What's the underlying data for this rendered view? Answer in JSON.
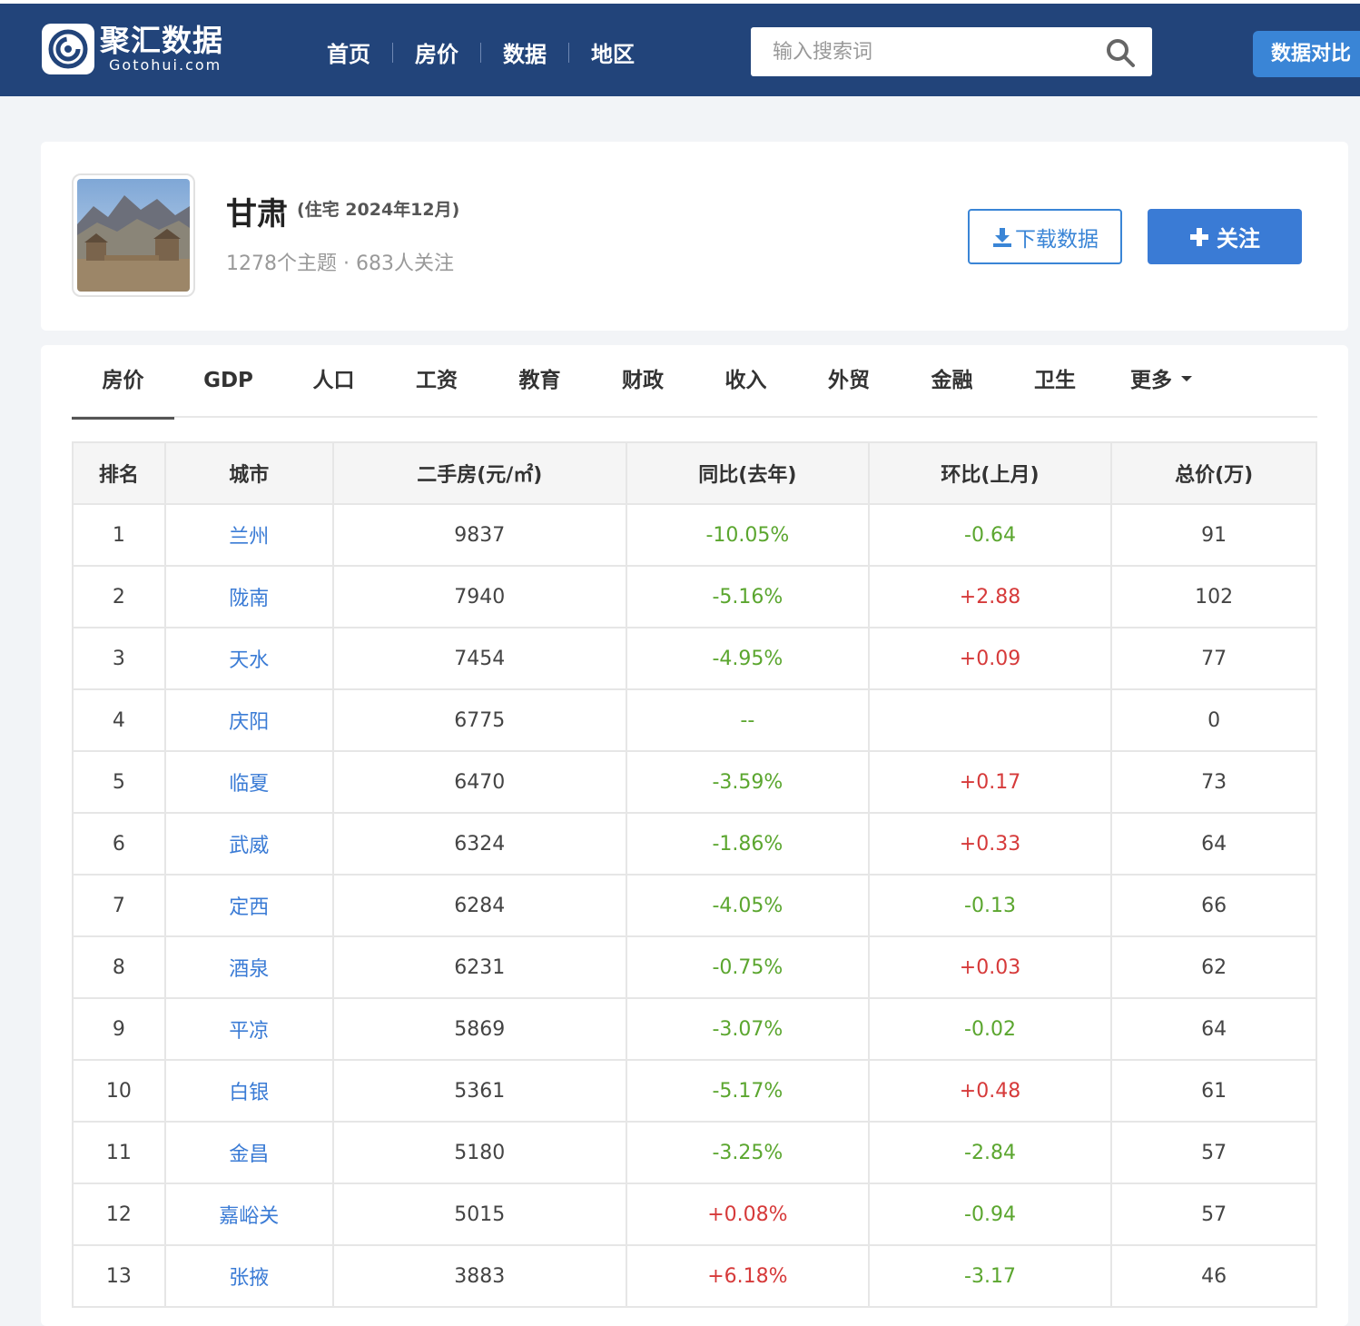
{
  "header": {
    "logo_name": "聚汇数据",
    "logo_domain": "Gotohui.com",
    "nav": [
      "首页",
      "房价",
      "数据",
      "地区"
    ],
    "search_placeholder": "输入搜索词",
    "compare_label": "数据对比"
  },
  "profile": {
    "title": "甘肃",
    "subtitle": "(住宅 2024年12月)",
    "meta": "1278个主题 · 683人关注",
    "download_label": "下载数据",
    "follow_label": "关注"
  },
  "tabs": [
    "房价",
    "GDP",
    "人口",
    "工资",
    "教育",
    "财政",
    "收入",
    "外贸",
    "金融",
    "卫生",
    "更多"
  ],
  "table": {
    "headers": [
      "排名",
      "城市",
      "二手房(元/㎡)",
      "同比(去年)",
      "环比(上月)",
      "总价(万)"
    ],
    "rows": [
      {
        "rank": "1",
        "city": "兰州",
        "price": "9837",
        "yoy": "-10.05%",
        "mom": "-0.64",
        "total": "91"
      },
      {
        "rank": "2",
        "city": "陇南",
        "price": "7940",
        "yoy": "-5.16%",
        "mom": "+2.88",
        "total": "102"
      },
      {
        "rank": "3",
        "city": "天水",
        "price": "7454",
        "yoy": "-4.95%",
        "mom": "+0.09",
        "total": "77"
      },
      {
        "rank": "4",
        "city": "庆阳",
        "price": "6775",
        "yoy": "--",
        "mom": "",
        "total": "0"
      },
      {
        "rank": "5",
        "city": "临夏",
        "price": "6470",
        "yoy": "-3.59%",
        "mom": "+0.17",
        "total": "73"
      },
      {
        "rank": "6",
        "city": "武威",
        "price": "6324",
        "yoy": "-1.86%",
        "mom": "+0.33",
        "total": "64"
      },
      {
        "rank": "7",
        "city": "定西",
        "price": "6284",
        "yoy": "-4.05%",
        "mom": "-0.13",
        "total": "66"
      },
      {
        "rank": "8",
        "city": "酒泉",
        "price": "6231",
        "yoy": "-0.75%",
        "mom": "+0.03",
        "total": "62"
      },
      {
        "rank": "9",
        "city": "平凉",
        "price": "5869",
        "yoy": "-3.07%",
        "mom": "-0.02",
        "total": "64"
      },
      {
        "rank": "10",
        "city": "白银",
        "price": "5361",
        "yoy": "-5.17%",
        "mom": "+0.48",
        "total": "61"
      },
      {
        "rank": "11",
        "city": "金昌",
        "price": "5180",
        "yoy": "-3.25%",
        "mom": "-2.84",
        "total": "57"
      },
      {
        "rank": "12",
        "city": "嘉峪关",
        "price": "5015",
        "yoy": "+0.08%",
        "mom": "-0.94",
        "total": "57"
      },
      {
        "rank": "13",
        "city": "张掖",
        "price": "3883",
        "yoy": "+6.18%",
        "mom": "-3.17",
        "total": "46"
      }
    ]
  },
  "colors": {
    "header_bg": "#22447a",
    "accent": "#3a7bd5",
    "negative": "#5ba62f",
    "positive": "#d63a3a"
  }
}
